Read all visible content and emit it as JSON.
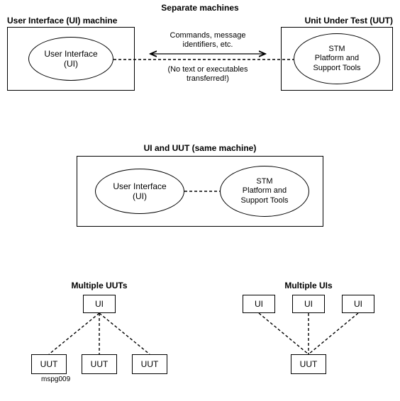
{
  "section1": {
    "title": "Separate machines",
    "left_label": "User Interface (UI) machine",
    "right_label": "Unit Under Test (UUT)",
    "ui_ellipse": "User Interface\n(UI)",
    "stm_ellipse": "STM\nPlatform and\nSupport Tools",
    "link_top": "Commands, message\nidentifiers, etc.",
    "link_bottom": "(No text or executables\ntransferred!)"
  },
  "section2": {
    "title": "UI and UUT (same machine)",
    "ui_ellipse": "User Interface\n(UI)",
    "stm_ellipse": "STM\nPlatform and\nSupport Tools"
  },
  "section3": {
    "left_title": "Multiple UUTs",
    "right_title": "Multiple UIs",
    "ui_label": "UI",
    "uut_label": "UUT"
  },
  "footer": "mspg009"
}
